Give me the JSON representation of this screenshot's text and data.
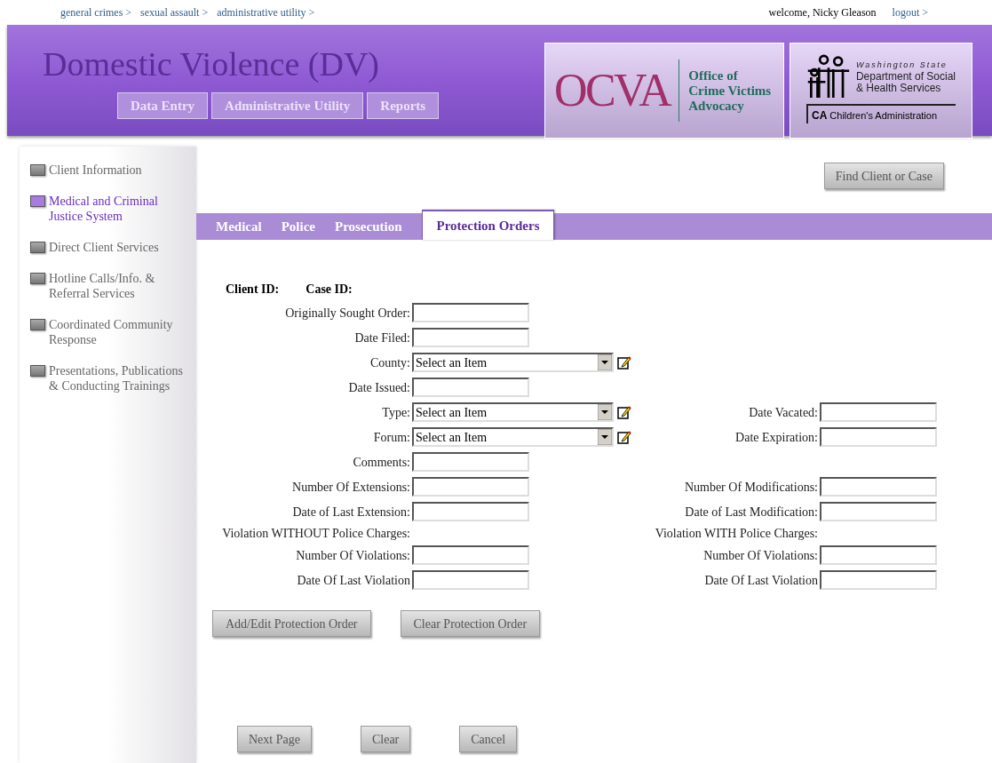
{
  "top_links": [
    "general crimes >",
    "sexual assault >",
    "administrative utility >"
  ],
  "welcome": "welcome, Nicky Gleason",
  "logout": "logout >",
  "header": {
    "title": "Domestic Violence (DV)",
    "nav": [
      "Data Entry",
      "Administrative Utility",
      "Reports"
    ],
    "ocva_logo": {
      "mark": "OCVA",
      "lines": [
        "Office of",
        "Crime Victims",
        "Advocacy"
      ]
    },
    "dshs_logo": {
      "state": "Washington State",
      "lines": [
        "Department of Social",
        "& Health Services"
      ],
      "ca": "CA",
      "division": "Children's Administration"
    }
  },
  "sidebar": {
    "items": [
      {
        "label": "Client Information",
        "selected": false
      },
      {
        "label": "Medical and Criminal Justice System",
        "selected": true
      },
      {
        "label": "Direct Client Services",
        "selected": false
      },
      {
        "label": "Hotline Calls/Info. & Referral Services",
        "selected": false
      },
      {
        "label": "Coordinated Community Response",
        "selected": false
      },
      {
        "label": "Presentations, Publications & Conducting Trainings",
        "selected": false
      }
    ]
  },
  "find_button": "Find Client or Case",
  "tabs": [
    {
      "label": "Medical",
      "selected": false
    },
    {
      "label": "Police",
      "selected": false
    },
    {
      "label": "Prosecution",
      "selected": false
    },
    {
      "label": "Protection Orders",
      "selected": true
    }
  ],
  "ids": [
    "Client ID:",
    "Case ID:"
  ],
  "form_rows": [
    {
      "left": {
        "kind": "text",
        "label": "Originally Sought Order:"
      }
    },
    {
      "left": {
        "kind": "text",
        "label": "Date Filed:"
      }
    },
    {
      "left": {
        "kind": "select",
        "label": "County:",
        "value": "Select an Item"
      }
    },
    {
      "left": {
        "kind": "text",
        "label": "Date Issued:"
      }
    },
    {
      "left": {
        "kind": "select",
        "label": "Type:",
        "value": "Select an Item"
      },
      "right": {
        "kind": "text",
        "label": "Date Vacated:"
      }
    },
    {
      "left": {
        "kind": "select",
        "label": "Forum:",
        "value": "Select an Item"
      },
      "right": {
        "kind": "text",
        "label": "Date Expiration:"
      }
    },
    {
      "left": {
        "kind": "text",
        "label": "Comments:"
      }
    },
    {
      "left": {
        "kind": "text",
        "label": "Number Of Extensions:"
      },
      "right": {
        "kind": "text",
        "label": "Number Of Modifications:"
      }
    },
    {
      "left": {
        "kind": "text",
        "label": "Date of Last Extension:"
      },
      "right": {
        "kind": "text",
        "label": "Date of Last Modification:"
      }
    },
    {
      "left": {
        "kind": "heading",
        "label": "Violation WITHOUT Police Charges:"
      },
      "right": {
        "kind": "heading",
        "label": "Violation WITH Police Charges:"
      }
    },
    {
      "left": {
        "kind": "text",
        "label": "Number Of Violations:"
      },
      "right": {
        "kind": "text",
        "label": "Number Of Violations:"
      }
    },
    {
      "left": {
        "kind": "text",
        "label": "Date Of Last Violation"
      },
      "right": {
        "kind": "text",
        "label": "Date Of Last Violation"
      }
    }
  ],
  "form_buttons": [
    "Add/Edit Protection Order",
    "Clear Protection Order"
  ],
  "bottom_buttons": [
    "Next Page",
    "Clear",
    "Cancel"
  ]
}
